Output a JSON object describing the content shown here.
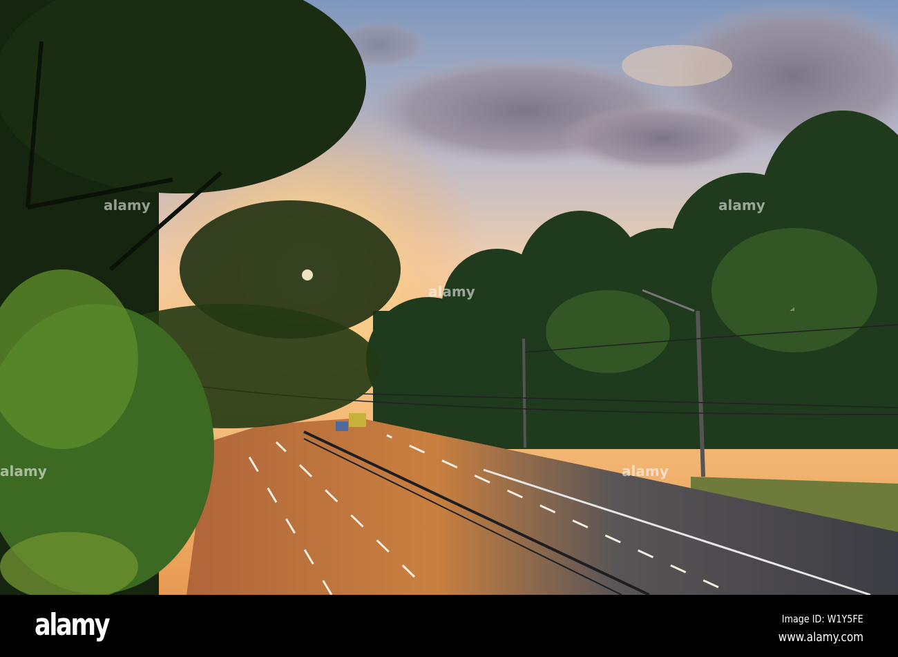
{
  "watermark": {
    "logo": "alamy",
    "image_id": "Image ID: W1Y5FE",
    "site": "www.alamy.com",
    "overlay_text": "alamy"
  },
  "colors": {
    "sky_top": "#7f97bd",
    "sun": "#ffe9a8",
    "foliage": "#1d3a17",
    "road": "#4b4a4f",
    "bar": "#000000"
  }
}
